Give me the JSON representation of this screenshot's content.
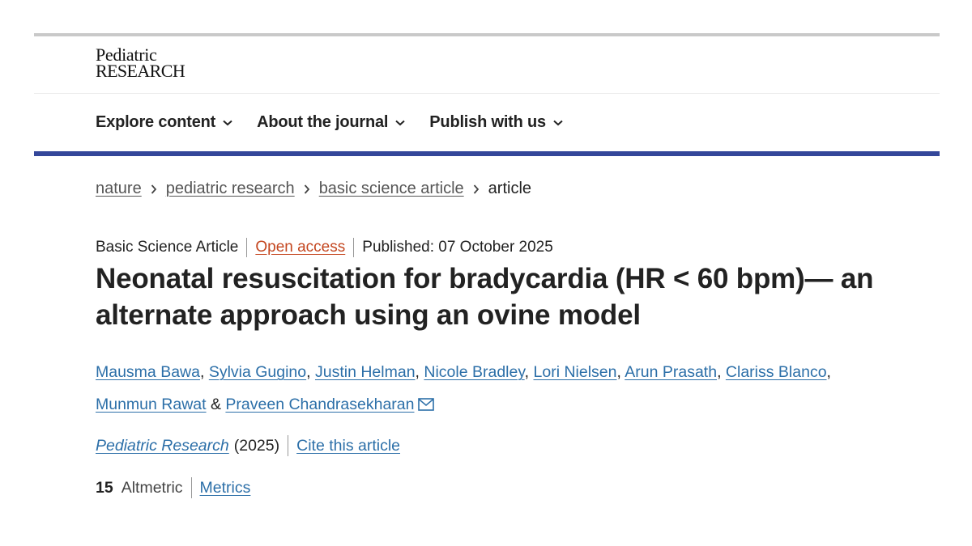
{
  "logo": {
    "line1": "Pediatric",
    "line2": "RESEARCH"
  },
  "nav": {
    "items": [
      {
        "label": "Explore content"
      },
      {
        "label": "About the journal"
      },
      {
        "label": "Publish with us"
      }
    ]
  },
  "breadcrumb": {
    "items": [
      "nature",
      "pediatric research",
      "basic science article"
    ],
    "current": "article"
  },
  "meta": {
    "type": "Basic Science Article",
    "access": "Open access",
    "published": "Published: 07 October 2025"
  },
  "title": "Neonatal resuscitation for bradycardia (HR < 60 bpm)— an alternate approach using an ovine model",
  "authors": {
    "names": [
      "Mausma Bawa",
      "Sylvia Gugino",
      "Justin Helman",
      "Nicole Bradley",
      "Lori Nielsen",
      "Arun Prasath",
      "Clariss Blanco",
      "Munmun Rawat",
      "Praveen Chandrasekharan"
    ],
    "separator": ", ",
    "conjunction": "&"
  },
  "citation": {
    "journal": "Pediatric Research",
    "year": "(2025)",
    "cite_label": "Cite this article"
  },
  "metrics": {
    "altmetric_count": "15",
    "altmetric_label": "Altmetric",
    "metrics_label": "Metrics"
  },
  "colors": {
    "accent_bar": "#34479a",
    "link": "#2c6fa8",
    "open_access": "#c4461f"
  },
  "icons": [
    "chevron-down-icon",
    "chevron-right-icon",
    "mail-icon"
  ]
}
